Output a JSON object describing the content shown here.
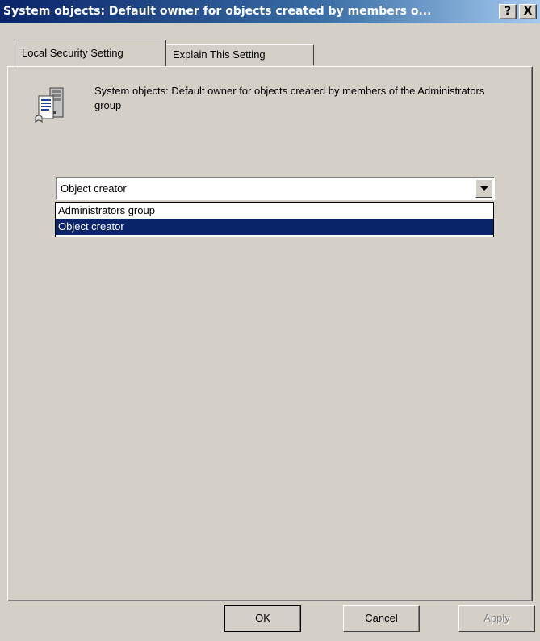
{
  "window": {
    "title": "System objects: Default owner for objects created by members o...",
    "help_label": "?",
    "close_label": "X"
  },
  "tabs": [
    {
      "label": "Local Security Setting",
      "active": true
    },
    {
      "label": "Explain This Setting",
      "active": false
    }
  ],
  "policy": {
    "icon": "policy-document-icon",
    "description": "System objects: Default owner for objects created by members of the Administrators group"
  },
  "combo": {
    "value": "Object creator",
    "options": [
      {
        "label": "Administrators group",
        "selected": false
      },
      {
        "label": "Object creator",
        "selected": true
      }
    ]
  },
  "buttons": {
    "ok": "OK",
    "cancel": "Cancel",
    "apply": "Apply"
  },
  "colors": {
    "face": "#d4d0c8",
    "title_active": "#0a246a",
    "selection": "#0a246a"
  }
}
